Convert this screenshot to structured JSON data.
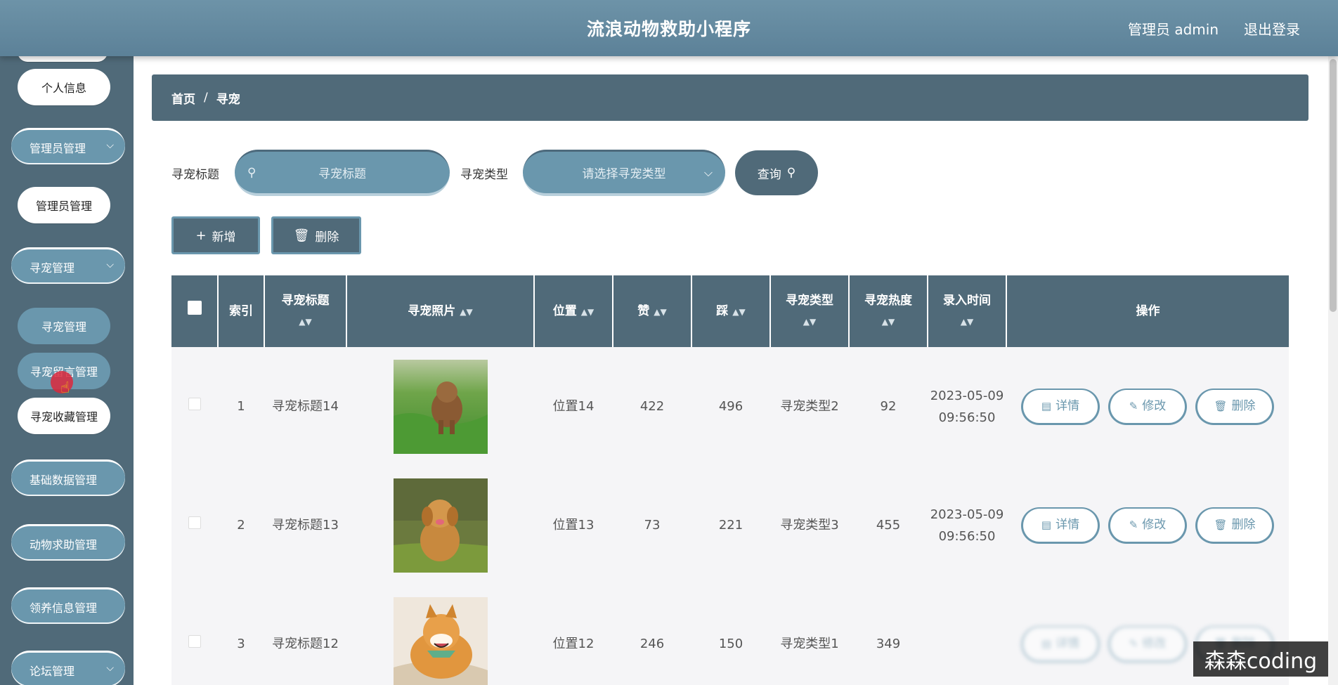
{
  "header": {
    "app_title": "流浪动物救助小程序",
    "user_label": "管理员 admin",
    "logout_label": "退出登录"
  },
  "sidebar": {
    "items": [
      {
        "label": "个人信息",
        "style": "white"
      },
      {
        "label": "管理员管理",
        "style": "group",
        "icon": "chevron-down-icon"
      },
      {
        "label": "管理员管理",
        "style": "white"
      },
      {
        "label": "寻宠管理",
        "style": "group",
        "icon": "chevron-down-icon"
      },
      {
        "label": "寻宠管理",
        "style": "sub-active"
      },
      {
        "label": "寻宠留言管理",
        "style": "sub-active"
      },
      {
        "label": "寻宠收藏管理",
        "style": "white"
      },
      {
        "label": "基础数据管理",
        "style": "group",
        "icon": "chevron-down-icon"
      },
      {
        "label": "动物求助管理",
        "style": "group",
        "icon": "chevron-down-icon"
      },
      {
        "label": "领养信息管理",
        "style": "group",
        "icon": "chevron-down-icon"
      },
      {
        "label": "论坛管理",
        "style": "group",
        "icon": "chevron-down-icon"
      }
    ]
  },
  "breadcrumb": {
    "home": "首页",
    "separator": "/",
    "current": "寻宠"
  },
  "search": {
    "title_label": "寻宠标题",
    "title_placeholder": "寻宠标题",
    "type_label": "寻宠类型",
    "type_placeholder": "请选择寻宠类型",
    "query_button": "查询"
  },
  "toolbar": {
    "add_label": "新增",
    "delete_label": "删除"
  },
  "table": {
    "columns": [
      "索引",
      "寻宠标题",
      "寻宠照片",
      "位置",
      "赞",
      "踩",
      "寻宠类型",
      "寻宠热度",
      "录入时间",
      "操作"
    ],
    "rows": [
      {
        "index": "1",
        "title": "寻宠标题14",
        "location": "位置14",
        "likes": "422",
        "dislikes": "496",
        "type": "寻宠类型2",
        "heat": "92",
        "time": "2023-05-09 09:56:50"
      },
      {
        "index": "2",
        "title": "寻宠标题13",
        "location": "位置13",
        "likes": "73",
        "dislikes": "221",
        "type": "寻宠类型3",
        "heat": "455",
        "time": "2023-05-09 09:56:50"
      },
      {
        "index": "3",
        "title": "寻宠标题12",
        "location": "位置12",
        "likes": "246",
        "dislikes": "150",
        "type": "寻宠类型1",
        "heat": "349",
        "time": ""
      }
    ],
    "actions": {
      "detail": "详情",
      "edit": "修改",
      "delete": "删除"
    }
  },
  "watermark": "森森coding",
  "colors": {
    "primary_dark": "#506a79",
    "primary_light": "#6a97ad",
    "header": "#6d93a8"
  }
}
